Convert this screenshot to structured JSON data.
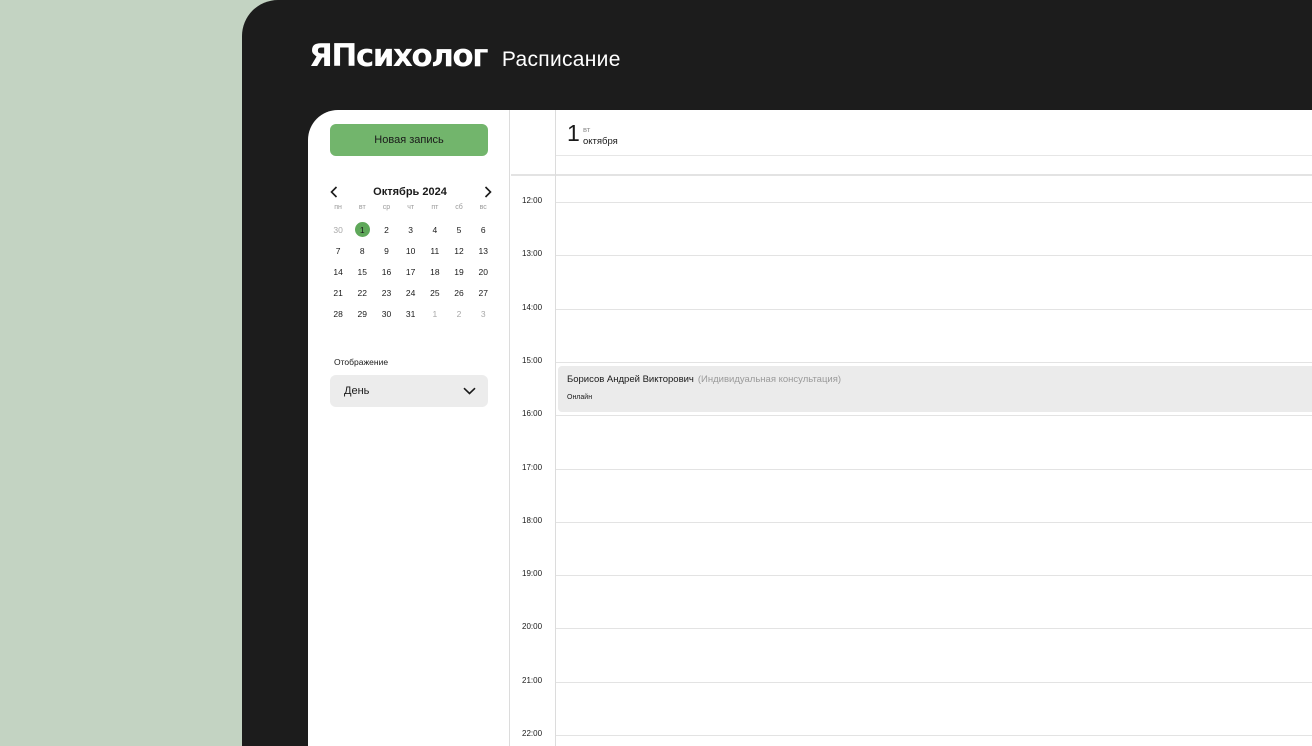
{
  "app": {
    "logo": "ЯПсихолог",
    "section": "Расписание"
  },
  "sidebar": {
    "new_button": "Новая запись",
    "calendar": {
      "month": "Октябрь 2024",
      "weekdays": [
        "пн",
        "вт",
        "ср",
        "чт",
        "пт",
        "сб",
        "вс"
      ],
      "days": [
        {
          "d": "30",
          "muted": true
        },
        {
          "d": "1",
          "selected": true
        },
        {
          "d": "2"
        },
        {
          "d": "3"
        },
        {
          "d": "4"
        },
        {
          "d": "5"
        },
        {
          "d": "6"
        },
        {
          "d": "7"
        },
        {
          "d": "8"
        },
        {
          "d": "9"
        },
        {
          "d": "10"
        },
        {
          "d": "11"
        },
        {
          "d": "12"
        },
        {
          "d": "13"
        },
        {
          "d": "14"
        },
        {
          "d": "15"
        },
        {
          "d": "16"
        },
        {
          "d": "17"
        },
        {
          "d": "18"
        },
        {
          "d": "19"
        },
        {
          "d": "20"
        },
        {
          "d": "21"
        },
        {
          "d": "22"
        },
        {
          "d": "23"
        },
        {
          "d": "24"
        },
        {
          "d": "25"
        },
        {
          "d": "26"
        },
        {
          "d": "27"
        },
        {
          "d": "28"
        },
        {
          "d": "29"
        },
        {
          "d": "30"
        },
        {
          "d": "31"
        },
        {
          "d": "1",
          "muted": true
        },
        {
          "d": "2",
          "muted": true
        },
        {
          "d": "3",
          "muted": true
        }
      ]
    },
    "view_label": "Отображение",
    "view_value": "День"
  },
  "schedule": {
    "date_number": "1",
    "date_weekday": "вт",
    "date_month": "октября",
    "hours": [
      "12:00",
      "13:00",
      "14:00",
      "15:00",
      "16:00",
      "17:00",
      "18:00",
      "19:00",
      "20:00",
      "21:00",
      "22:00"
    ],
    "event": {
      "client": "Борисов Андрей Викторович",
      "type": "(Индивидуальная консультация)",
      "format": "Онлайн"
    }
  },
  "colors": {
    "accent": "#72b56c",
    "selected_day": "#5fa85a",
    "frame": "#1c1c1c",
    "background": "#c3d3c2"
  }
}
